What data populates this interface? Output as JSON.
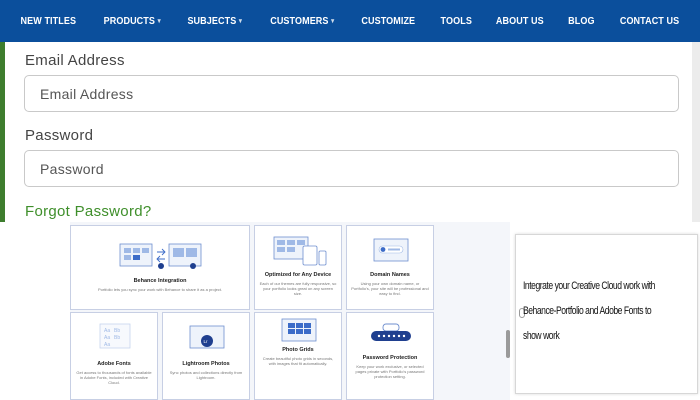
{
  "nav": {
    "items": [
      {
        "label": "NEW TITLES",
        "has_dropdown": false
      },
      {
        "label": "PRODUCTS",
        "has_dropdown": true
      },
      {
        "label": "SUBJECTS",
        "has_dropdown": true
      },
      {
        "label": "CUSTOMERS",
        "has_dropdown": true
      },
      {
        "label": "CUSTOMIZE",
        "has_dropdown": false
      },
      {
        "label": "TOOLS",
        "has_dropdown": false
      },
      {
        "label": "ABOUT US",
        "has_dropdown": false
      },
      {
        "label": "BLOG",
        "has_dropdown": false
      },
      {
        "label": "CONTACT US",
        "has_dropdown": false
      }
    ],
    "caret": "▾",
    "background": "#0b4f9c"
  },
  "login": {
    "email_label": "Email Address",
    "email_placeholder": "Email Address",
    "password_label": "Password",
    "password_placeholder": "Password",
    "forgot_link": "Forgot Password?",
    "forgot_color": "#3f8f2b"
  },
  "features": [
    {
      "title": "Behance Integration",
      "desc": "Portfolio lets you sync your work with Behance to share it as a project.",
      "icon": "behance-sync-icon"
    },
    {
      "title": "Optimized for Any Device",
      "desc": "Each of our themes are fully responsive, so your portfolio looks great on any screen size.",
      "icon": "devices-icon"
    },
    {
      "title": "Domain Names",
      "desc": "Using your own domain name, or Portfolio's, your site will be professional and easy to find.",
      "icon": "domain-icon"
    },
    {
      "title": "Adobe Fonts",
      "desc": "Get access to thousands of fonts available in Adobe Fonts, included with Creative Cloud.",
      "icon": "fonts-icon"
    },
    {
      "title": "Lightroom Photos",
      "desc": "Sync photos and collections directly from Lightroom.",
      "icon": "lightroom-icon"
    },
    {
      "title": "Photo Grids",
      "desc": "Create beautiful photo grids in seconds, with images that fit automatically.",
      "icon": "photo-grid-icon"
    },
    {
      "title": "Password Protection",
      "desc": "Keep your work exclusive, or selected pages private with Portfolio's password protection setting.",
      "icon": "password-icon"
    }
  ],
  "side_panel": {
    "text": "Integrate your Creative Cloud work with Behance-Portfolio and Adobe Fonts to show work"
  }
}
